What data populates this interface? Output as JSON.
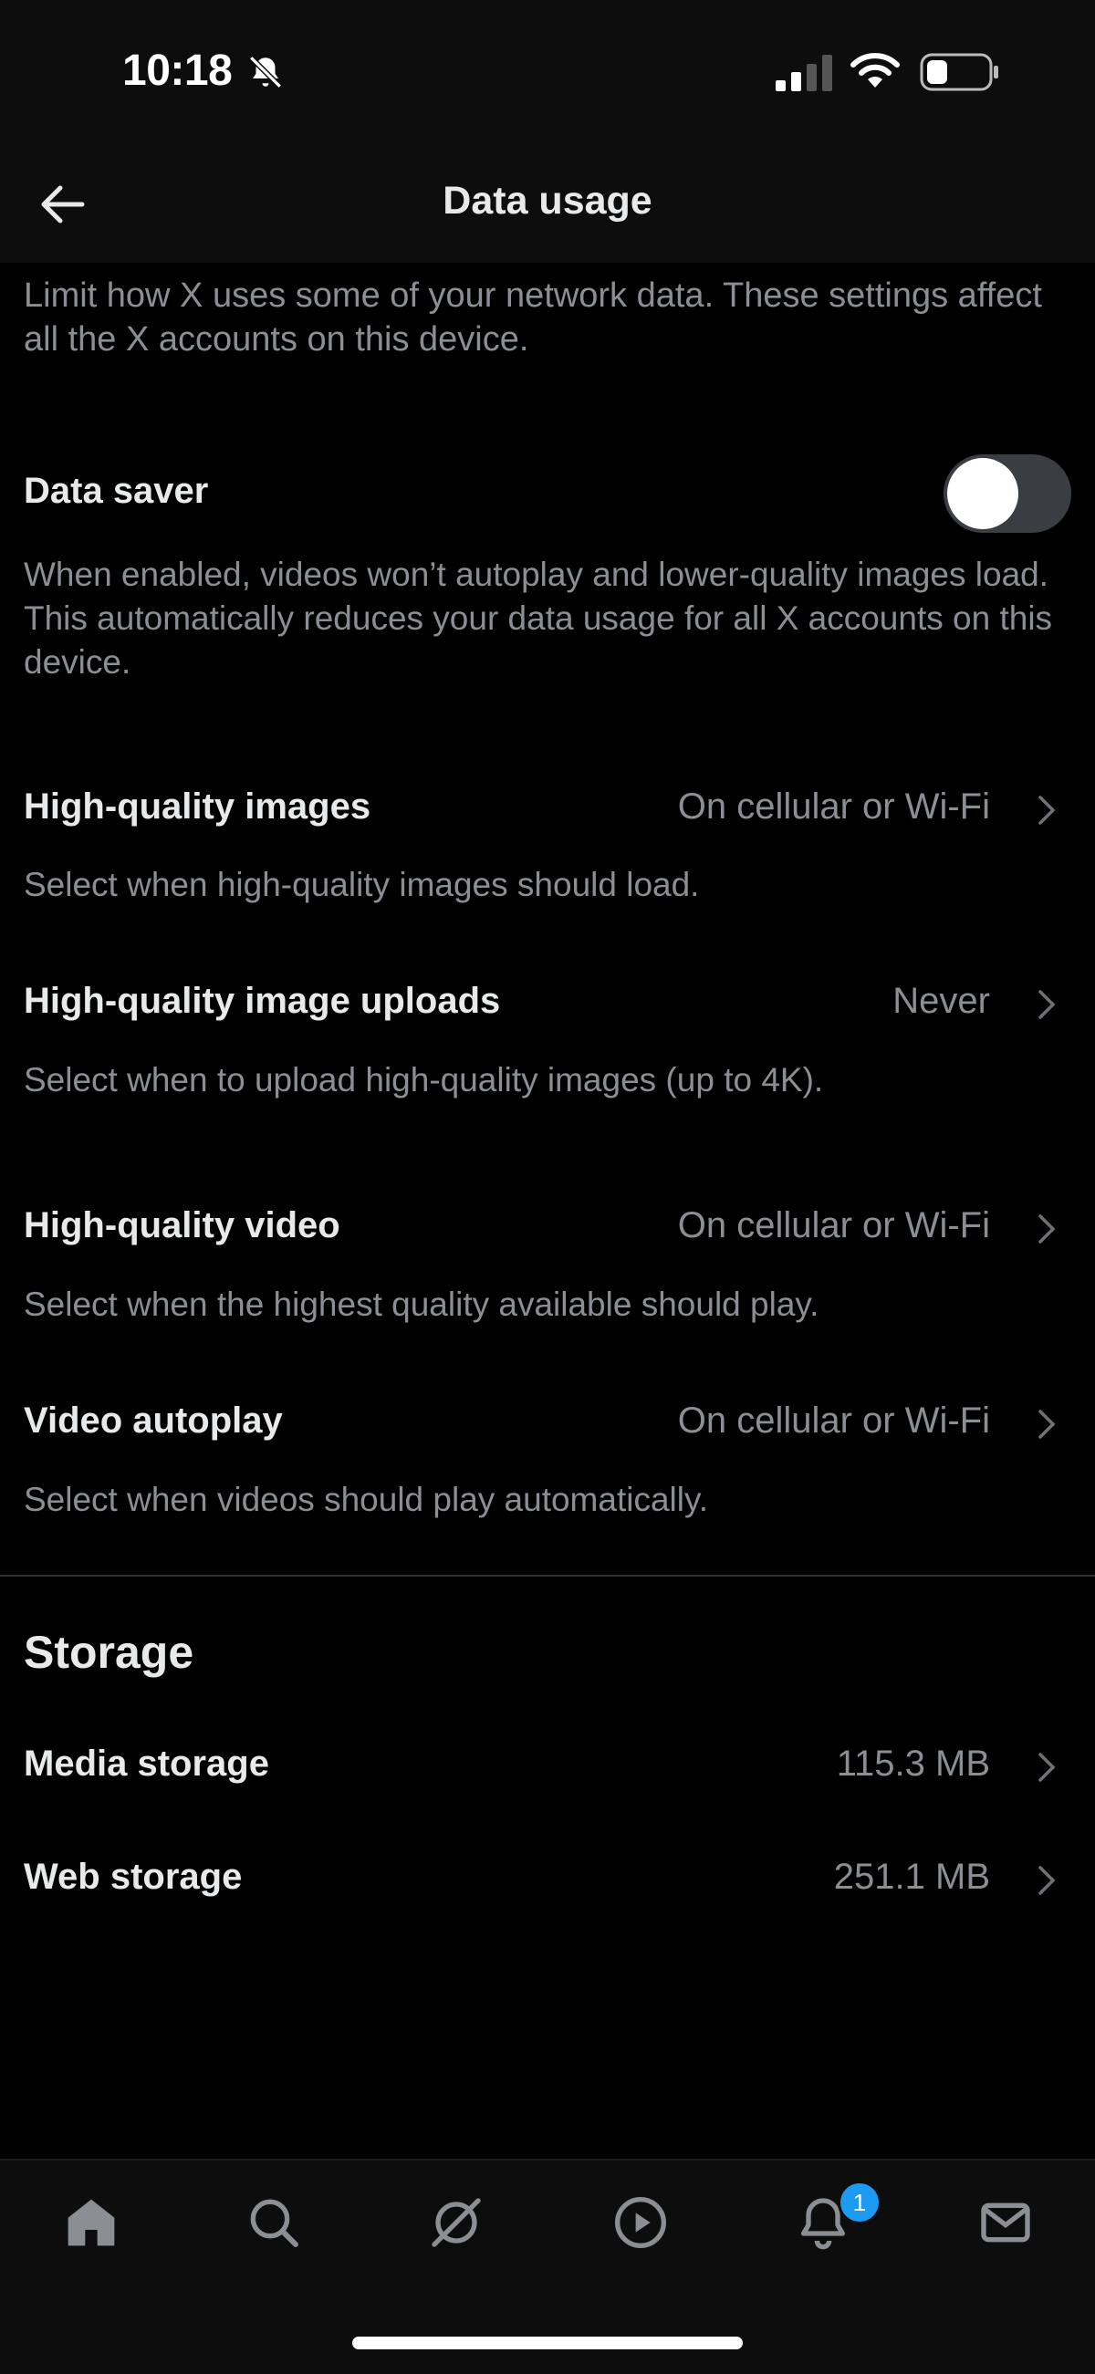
{
  "status_bar": {
    "time": "10:18"
  },
  "header": {
    "title": "Data usage"
  },
  "intro": "Limit how X uses some of your network data. These settings affect all the X accounts on this device.",
  "data_saver": {
    "label": "Data saver",
    "enabled": false,
    "description": "When enabled, videos won’t autoplay and lower-quality images load. This automatically reduces your data usage for all X accounts on this device."
  },
  "settings": [
    {
      "label": "High-quality images",
      "value": "On cellular or Wi-Fi",
      "description": "Select when high-quality images should load."
    },
    {
      "label": "High-quality image uploads",
      "value": "Never",
      "description": "Select when to upload high-quality images (up to 4K)."
    },
    {
      "label": "High-quality video",
      "value": "On cellular or Wi-Fi",
      "description": "Select when the highest quality available should play."
    },
    {
      "label": "Video autoplay",
      "value": "On cellular or Wi-Fi",
      "description": "Select when videos should play automatically."
    }
  ],
  "storage": {
    "title": "Storage",
    "items": [
      {
        "label": "Media storage",
        "value": "115.3 MB"
      },
      {
        "label": "Web storage",
        "value": "251.1 MB"
      }
    ]
  },
  "tab_bar": {
    "tabs": [
      "home-icon",
      "search-icon",
      "grok-icon",
      "video-icon",
      "notifications-icon",
      "messages-icon"
    ],
    "notifications_badge": "1"
  },
  "colors": {
    "accent": "#1d9bf0",
    "background": "#000000",
    "secondary_text": "#8b8f94"
  }
}
